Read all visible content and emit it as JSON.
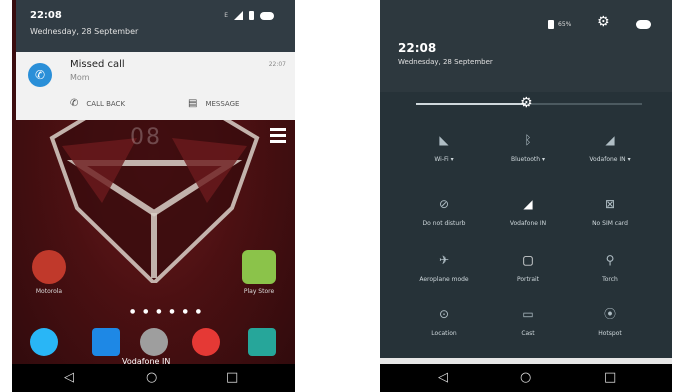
{
  "left_screen": {
    "status": {
      "time": "22:08",
      "date": "Wednesday, 28 September",
      "network_label": "E",
      "icons": [
        "signal-icon",
        "battery-icon",
        "cloud-icon"
      ]
    },
    "notification": {
      "title": "Missed call",
      "subtitle": "Mom",
      "time": "22:07",
      "actions": [
        {
          "label": "CALL BACK",
          "icon": "phone-icon"
        },
        {
          "label": "MESSAGE",
          "icon": "message-icon"
        }
      ]
    },
    "clock_overlay": "08",
    "apps": [
      {
        "label": "Motorola",
        "color": "#c0392b"
      },
      {
        "label": "Play Store",
        "color": "#8bc34a"
      }
    ],
    "dock": {
      "carrier": "Vodafone IN",
      "icons": [
        "phone-icon",
        "messages-icon",
        "app-drawer-icon",
        "chrome-icon",
        "camera-icon"
      ]
    },
    "nav": {
      "back": "◁",
      "home": "○",
      "recents": "□"
    }
  },
  "right_screen": {
    "status": {
      "time": "22:08",
      "date": "Wednesday, 28 September",
      "battery": "65%"
    },
    "tiles": [
      {
        "label": "Wi-Fi",
        "icon": "wifi-icon",
        "dropdown": true
      },
      {
        "label": "Bluetooth",
        "icon": "bluetooth-icon",
        "dropdown": true
      },
      {
        "label": "Vodafone IN",
        "icon": "signal-off-icon",
        "dropdown": true
      },
      {
        "label": "Do not disturb",
        "icon": "dnd-icon",
        "dropdown": false
      },
      {
        "label": "Vodafone IN",
        "icon": "signal-icon",
        "dropdown": false
      },
      {
        "label": "No SIM card",
        "icon": "no-sim-icon",
        "dropdown": false
      },
      {
        "label": "Aeroplane mode",
        "icon": "airplane-icon",
        "dropdown": false
      },
      {
        "label": "Portrait",
        "icon": "portrait-icon",
        "dropdown": false
      },
      {
        "label": "Torch",
        "icon": "torch-icon",
        "dropdown": false
      },
      {
        "label": "Location",
        "icon": "location-icon",
        "dropdown": false
      },
      {
        "label": "Cast",
        "icon": "cast-icon",
        "dropdown": false
      },
      {
        "label": "Hotspot",
        "icon": "hotspot-icon",
        "dropdown": false
      }
    ],
    "brightness": 0.5,
    "nav": {
      "back": "◁",
      "home": "○",
      "recents": "□"
    }
  }
}
